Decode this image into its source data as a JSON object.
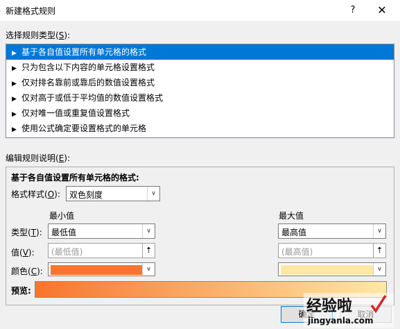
{
  "window": {
    "title": "新建格式规则",
    "help_glyph": "?",
    "close_glyph": "✕"
  },
  "rule_type": {
    "label": "选择规则类型(",
    "hotkey": "S",
    "label_end": "):",
    "items": [
      {
        "label": "基于各自值设置所有单元格的格式",
        "selected": true
      },
      {
        "label": "只为包含以下内容的单元格设置格式",
        "selected": false
      },
      {
        "label": "仅对排名靠前或靠后的数值设置格式",
        "selected": false
      },
      {
        "label": "仅对高于或低于平均值的数值设置格式",
        "selected": false
      },
      {
        "label": "仅对唯一值或重复值设置格式",
        "selected": false
      },
      {
        "label": "使用公式确定要设置格式的单元格",
        "selected": false
      }
    ]
  },
  "rule_desc": {
    "label": "编辑规则说明(",
    "hotkey": "E",
    "label_end": "):",
    "heading": "基于各自值设置所有单元格的格式:",
    "format_style_label": "格式样式(",
    "format_style_hotkey": "O",
    "format_style_end": "):",
    "format_style_value": "双色刻度",
    "min_header": "最小值",
    "max_header": "最大值",
    "type_label": "类型(",
    "type_hotkey": "T",
    "type_end": "):",
    "value_label": "值(",
    "value_hotkey": "V",
    "value_end": "):",
    "color_label": "颜色(",
    "color_hotkey": "C",
    "color_end": "):",
    "min_type": "最低值",
    "max_type": "最高值",
    "min_value_placeholder": "(最低值)",
    "max_value_placeholder": "(最高值)",
    "min_color": "#f8752d",
    "max_color": "#ffe8a3",
    "preview_label": "预览:",
    "ref_glyph": "⇡",
    "arrow_glyph": "∨"
  },
  "buttons": {
    "ok": "确定",
    "cancel": "取消"
  },
  "watermark": {
    "text": "经验啦",
    "url": "jingyanla.com"
  }
}
